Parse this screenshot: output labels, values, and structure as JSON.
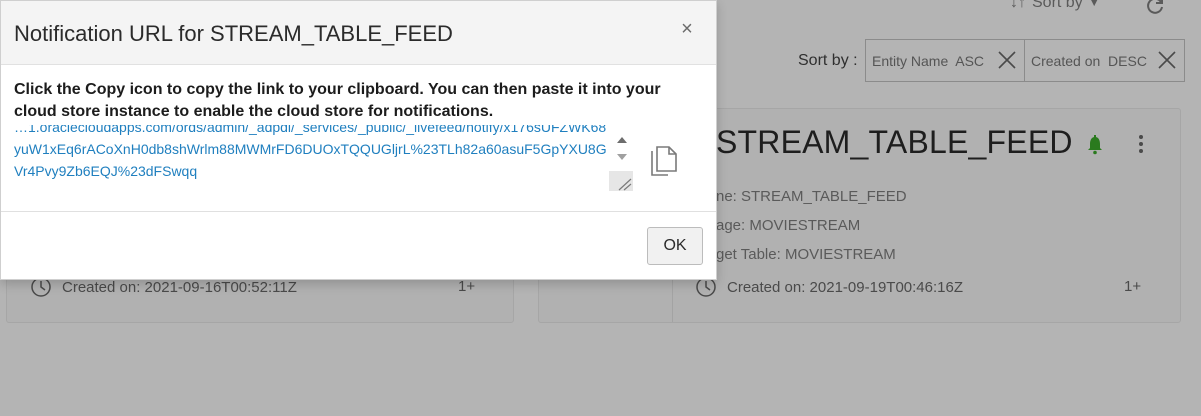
{
  "dialog": {
    "title": "Notification URL for STREAM_TABLE_FEED",
    "close_label": "×",
    "instructions": "Click the Copy icon to copy the link to your clipboard. You can then paste it into your cloud store instance to enable the cloud store for notifications.",
    "url_value": "…1.oraclecloudapps.com/ords/admin/_adpdi/_services/_public/_livefeed/notify/x176sUFZWK68yuW1xEq6rACoXnH0db8shWrlm88MWMrFD6DUOxTQQUGljrL%23TLh82a60asuF5GpYXU8GVr4Pvy9Zb6EQJ%23dFSwqq",
    "copy_icon": "copy-icon",
    "ok_label": "OK"
  },
  "page": {
    "sort_menu_label": "Sort by",
    "sortby_label": "Sort by :",
    "sort_chips": [
      {
        "label": "Entity Name  ASC"
      },
      {
        "label": "Created on  DESC"
      }
    ],
    "cards": [
      {
        "created": "Created on: 2021-09-16T00:52:11Z",
        "count": "1+"
      },
      {
        "title": "STREAM_TABLE_FEED",
        "name_line": "ne: STREAM_TABLE_FEED",
        "stage_line": "age: MOVIESTREAM",
        "target_line": "get Table: MOVIESTREAM",
        "created": "Created on: 2021-09-19T00:46:16Z",
        "count": "1+"
      }
    ]
  },
  "colors": {
    "link": "#1f7fbf",
    "overlay_bg": "#b4b4b4",
    "bell_green": "#2a7a1e"
  }
}
